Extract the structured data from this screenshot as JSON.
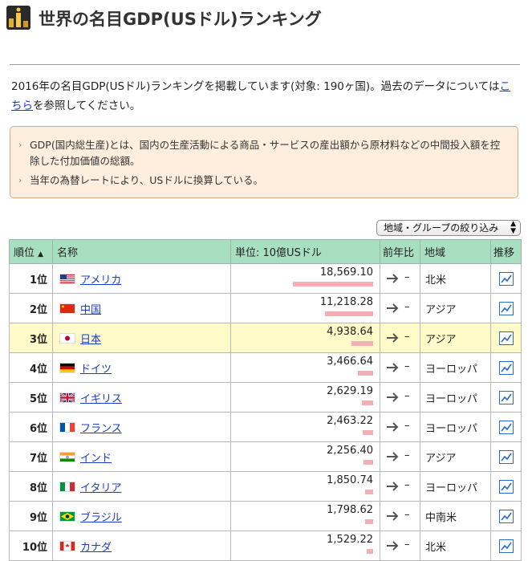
{
  "page": {
    "title": "世界の名目GDP(USドル)ランキング",
    "intro_before_link": "2016年の名目GDP(USドル)ランキングを掲載しています(対象: 190ヶ国)。過去のデータについては",
    "intro_link": "こちら",
    "intro_after_link": "を参照してください。"
  },
  "notes": [
    "GDP(国内総生産)とは、国内の生産活動による商品・サービスの産出額から原材料などの中間投入額を控除した付加価値の総額。",
    "当年の為替レートにより、USドルに換算している。"
  ],
  "filter": {
    "label": "地域・グループの絞り込み"
  },
  "table": {
    "headers": {
      "rank": "順位",
      "sort_indicator": "▲",
      "name": "名称",
      "unit": "単位: 10億USドル",
      "change": "前年比",
      "region": "地域",
      "trend": "推移"
    },
    "max_value": 18569.1,
    "rows": [
      {
        "rank": "1位",
        "country": "アメリカ",
        "value": "18,569.10",
        "num": 18569.1,
        "change": "–",
        "region": "北米",
        "flag": "us"
      },
      {
        "rank": "2位",
        "country": "中国",
        "value": "11,218.28",
        "num": 11218.28,
        "change": "–",
        "region": "アジア",
        "flag": "cn"
      },
      {
        "rank": "3位",
        "country": "日本",
        "value": "4,938.64",
        "num": 4938.64,
        "change": "–",
        "region": "アジア",
        "flag": "jp",
        "highlight": true
      },
      {
        "rank": "4位",
        "country": "ドイツ",
        "value": "3,466.64",
        "num": 3466.64,
        "change": "–",
        "region": "ヨーロッパ",
        "flag": "de"
      },
      {
        "rank": "5位",
        "country": "イギリス",
        "value": "2,629.19",
        "num": 2629.19,
        "change": "–",
        "region": "ヨーロッパ",
        "flag": "gb"
      },
      {
        "rank": "6位",
        "country": "フランス",
        "value": "2,463.22",
        "num": 2463.22,
        "change": "–",
        "region": "ヨーロッパ",
        "flag": "fr"
      },
      {
        "rank": "7位",
        "country": "インド",
        "value": "2,256.40",
        "num": 2256.4,
        "change": "–",
        "region": "アジア",
        "flag": "in"
      },
      {
        "rank": "8位",
        "country": "イタリア",
        "value": "1,850.74",
        "num": 1850.74,
        "change": "–",
        "region": "ヨーロッパ",
        "flag": "it"
      },
      {
        "rank": "9位",
        "country": "ブラジル",
        "value": "1,798.62",
        "num": 1798.62,
        "change": "–",
        "region": "中南米",
        "flag": "br"
      },
      {
        "rank": "10位",
        "country": "カナダ",
        "value": "1,529.22",
        "num": 1529.22,
        "change": "–",
        "region": "北米",
        "flag": "ca"
      }
    ]
  },
  "colors": {
    "header_bg": "#a8dfc0",
    "highlight_row": "#fffbc8",
    "bar": "#f3b0b4",
    "link": "#1a3cc8",
    "note_bg": "#fdeedd"
  }
}
